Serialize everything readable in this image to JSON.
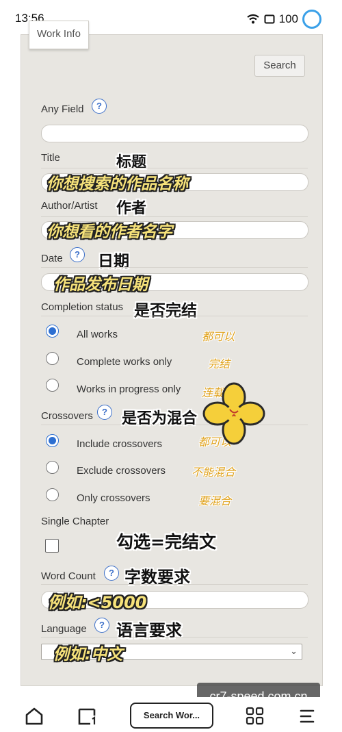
{
  "status": {
    "time": "13:56",
    "battery": "100"
  },
  "form": {
    "tab_label": "Work Info",
    "search_button": "Search",
    "any_field": {
      "label": "Any Field",
      "help": "?"
    },
    "title": {
      "label": "Title",
      "annotation": "标题",
      "placeholder_note": "你想搜索的作品名称"
    },
    "author": {
      "label": "Author/Artist",
      "annotation": "作者",
      "placeholder_note": "你想看的作者名字"
    },
    "date": {
      "label": "Date",
      "help": "?",
      "annotation": "日期",
      "placeholder_note": "作品发布日期"
    },
    "completion": {
      "label": "Completion status",
      "annotation": "是否完结",
      "options": [
        {
          "label": "All works",
          "note": "都可以",
          "selected": true
        },
        {
          "label": "Complete works only",
          "note": "完结",
          "selected": false
        },
        {
          "label": "Works in progress only",
          "note": "连载",
          "selected": false
        }
      ]
    },
    "crossovers": {
      "label": "Crossovers",
      "help": "?",
      "annotation": "是否为混合",
      "options": [
        {
          "label": "Include crossovers",
          "note": "都可以",
          "selected": true
        },
        {
          "label": "Exclude crossovers",
          "note": "不能混合",
          "selected": false
        },
        {
          "label": "Only crossovers",
          "note": "要混合",
          "selected": false
        }
      ]
    },
    "single_chapter": {
      "label": "Single Chapter",
      "annotation": "勾选=完结文"
    },
    "word_count": {
      "label": "Word Count",
      "help": "?",
      "annotation": "字数要求",
      "placeholder_note": "例如:<5000"
    },
    "language": {
      "label": "Language",
      "help": "?",
      "annotation": "语言要求",
      "placeholder_note": "例如:中文"
    }
  },
  "watermark": "cr7-speed.com.cn",
  "nav": {
    "search_label": "Search Wor..."
  },
  "colors": {
    "accent": "#2d6fd1",
    "panel": "#e8e6e1",
    "annotation_yellow": "#f6e27a"
  }
}
